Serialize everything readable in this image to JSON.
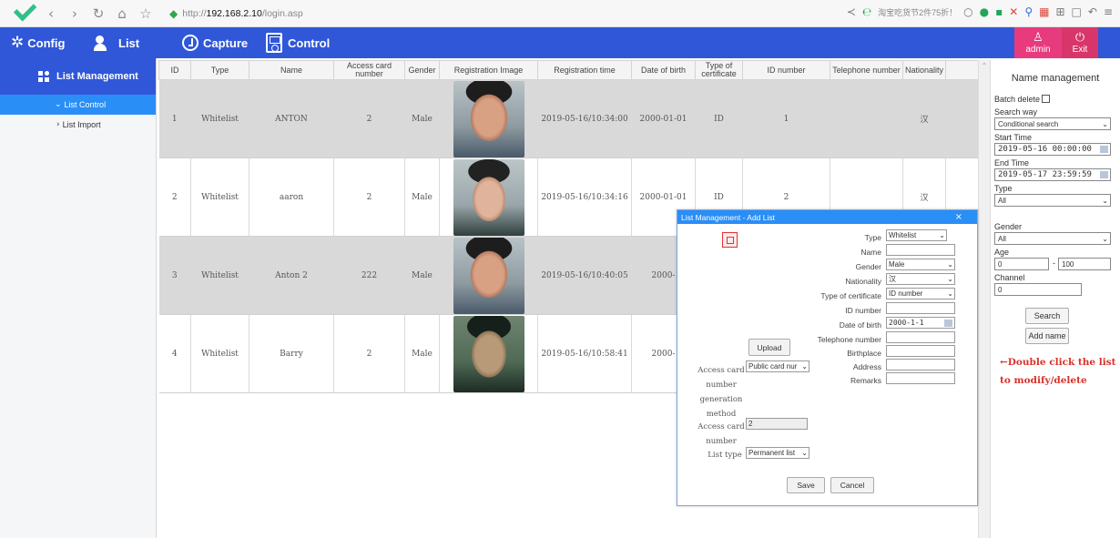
{
  "browser": {
    "url_proto": "http://",
    "url_host": "192.168.2.10",
    "url_path": "/login.asp",
    "promo": "淘宝吃货节2件75折！"
  },
  "header": {
    "nav": [
      "Config",
      "List",
      "Capture",
      "Control"
    ],
    "user": "admin",
    "exit": "Exit"
  },
  "sidebar": {
    "title": "List Management",
    "items": [
      "List Control",
      "List Import"
    ]
  },
  "table": {
    "columns": [
      "ID",
      "Type",
      "Name",
      "Access card number",
      "Gender",
      "Registration Image",
      "Registration time",
      "Date of birth",
      "Type of certificate",
      "ID number",
      "Telephone number",
      "Nationality"
    ],
    "rows": [
      {
        "id": "1",
        "type": "Whitelist",
        "name": "ANTON",
        "card": "2",
        "gender": "Male",
        "time": "2019-05-16/10:34:00",
        "dob": "2000-01-01",
        "cert": "ID",
        "idnum": "1",
        "phone": "",
        "nat": "汉"
      },
      {
        "id": "2",
        "type": "Whitelist",
        "name": "aaron",
        "card": "2",
        "gender": "Male",
        "time": "2019-05-16/10:34:16",
        "dob": "2000-01-01",
        "cert": "ID",
        "idnum": "2",
        "phone": "",
        "nat": "汉"
      },
      {
        "id": "3",
        "type": "Whitelist",
        "name": "Anton 2",
        "card": "222",
        "gender": "Male",
        "time": "2019-05-16/10:40:05",
        "dob": "2000-",
        "cert": "",
        "idnum": "",
        "phone": "",
        "nat": ""
      },
      {
        "id": "4",
        "type": "Whitelist",
        "name": "Barry",
        "card": "2",
        "gender": "Male",
        "time": "2019-05-16/10:58:41",
        "dob": "2000-",
        "cert": "",
        "idnum": "",
        "phone": "",
        "nat": ""
      }
    ]
  },
  "panel": {
    "title": "Name management",
    "batch_delete": "Batch delete",
    "search_way_label": "Search way",
    "search_way": "Conditional search",
    "start_label": "Start Time",
    "start": "2019-05-16 00:00:00",
    "end_label": "End Time",
    "end": "2019-05-17 23:59:59",
    "type_label": "Type",
    "type": "All",
    "gender_label": "Gender",
    "gender": "All",
    "age_label": "Age",
    "age_from": "0",
    "age_sep": "-",
    "age_to": "100",
    "channel_label": "Channel",
    "channel": "0",
    "search_btn": "Search",
    "add_btn": "Add name",
    "hint": "←Double click the list to modify/delete"
  },
  "dialog": {
    "title": "List Management - Add List",
    "close": "×",
    "labels": {
      "type": "Type",
      "name": "Name",
      "gender": "Gender",
      "nationality": "Nationality",
      "cert": "Type of certificate",
      "idnum": "ID number",
      "dob": "Date of birth",
      "phone": "Telephone number",
      "birthplace": "Birthplace",
      "address": "Address",
      "remarks": "Remarks"
    },
    "values": {
      "type": "Whitelist",
      "name": "",
      "gender": "Male",
      "nationality": "汉",
      "cert": "ID number",
      "idnum": "",
      "dob": "2000-1-1",
      "phone": "",
      "birthplace": "",
      "address": "",
      "remarks": ""
    },
    "upload": "Upload",
    "card_method_label": [
      "Access card",
      "number",
      "generation",
      "method"
    ],
    "card_method": "Public card nur",
    "card_number_label": [
      "Access card",
      "number"
    ],
    "card_number": "2",
    "list_type_label": "List type",
    "list_type": "Permanent list",
    "save": "Save",
    "cancel": "Cancel"
  },
  "colors": {
    "header_blue": "#3057d8",
    "active_blue": "#2a8ef7",
    "admin_pink": "#e73b7e",
    "hint_red": "#d7322a"
  }
}
